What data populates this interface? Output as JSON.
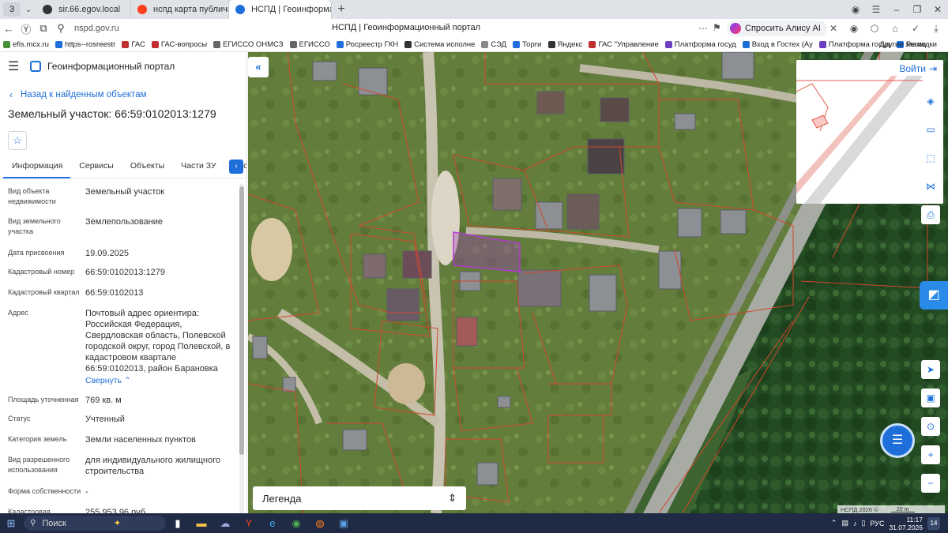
{
  "browser": {
    "tab_count": "3",
    "tabs": [
      {
        "title": "sir.66.egov.local",
        "favicon_color": "#333333"
      },
      {
        "title": "нспд карта публичная кад",
        "favicon_color": "#fc3f1d"
      },
      {
        "title": "НСПД | Геоинформацио",
        "favicon_color": "#1e6fd9"
      }
    ],
    "url": "nspd.gov.ru",
    "page_title": "НСПД | Геоинформационный портал",
    "alice_label": "Спросить Алису AI",
    "bookmarks": [
      {
        "label": "efis.mcx.ru",
        "color": "#4a8f3a"
      },
      {
        "label": "https--rosreestr",
        "color": "#1e6fd9"
      },
      {
        "label": "ГАС",
        "color": "#c03030"
      },
      {
        "label": "ГАС-вопросы",
        "color": "#c03030"
      },
      {
        "label": "ЕГИССО ОНМСЗ",
        "color": "#666666"
      },
      {
        "label": "ЕГИССО",
        "color": "#666666"
      },
      {
        "label": "Росреестр ГКН",
        "color": "#1e6fd9"
      },
      {
        "label": "Система исполне",
        "color": "#333333"
      },
      {
        "label": "СЭД",
        "color": "#888888"
      },
      {
        "label": "Торги",
        "color": "#1e6fd9"
      },
      {
        "label": "Яндекс",
        "color": "#333333"
      },
      {
        "label": "ГАС \"Управление",
        "color": "#c03030"
      },
      {
        "label": "Платформа госуд",
        "color": "#6a3fc0"
      },
      {
        "label": "Вход в Гостех (Ау",
        "color": "#1e6fd9"
      },
      {
        "label": "Платформа госуд",
        "color": "#6a3fc0"
      },
      {
        "label": "Регио",
        "color": "#1e6fd9"
      }
    ],
    "other_bookmarks": "Другие закладки"
  },
  "panel": {
    "app_name": "Геоинформационный портал",
    "back_label": "Назад к найденным объектам",
    "object_title": "Земельный участок: 66:59:0102013:1279",
    "tabs": [
      "Информация",
      "Сервисы",
      "Объекты",
      "Части ЗУ",
      "Состав"
    ],
    "attributes": [
      {
        "key": "Вид объекта недвижимости",
        "value": "Земельный участок"
      },
      {
        "key": "Вид земельного участка",
        "value": "Землепользование"
      },
      {
        "key": "Дата присвоения",
        "value": "19.09.2025"
      },
      {
        "key": "Кадастровый номер",
        "value": "66:59:0102013:1279"
      },
      {
        "key": "Кадастровый квартал",
        "value": "66:59:0102013"
      },
      {
        "key": "Адрес",
        "value": "Почтовый адрес ориентира: Российская Федерация, Свердловская область, Полевской городской округ, город Полевской, в кадастровом квартале 66:59:0102013, район Барановка"
      },
      {
        "key": "Площадь уточненная",
        "value": "769 кв. м"
      },
      {
        "key": "Статус",
        "value": "Учтенный"
      },
      {
        "key": "Категория земель",
        "value": "Земли населенных пунктов"
      },
      {
        "key": "Вид разрешенного использования",
        "value": "для индивидуального жилищного строительства"
      },
      {
        "key": "Форма собственности",
        "value": "-"
      },
      {
        "key": "Кадастровая",
        "value": "255 953,96 руб."
      }
    ],
    "collapse_label": "Свернуть"
  },
  "map": {
    "login_label": "Войти",
    "legend_label": "Легенда",
    "copyright": "НСПД 2026 ©",
    "scale_label": "20 m"
  },
  "taskbar": {
    "search_label": "Поиск",
    "lang": "РУС",
    "time": "11:17",
    "date": "31.07.2026",
    "notif_count": "14"
  }
}
